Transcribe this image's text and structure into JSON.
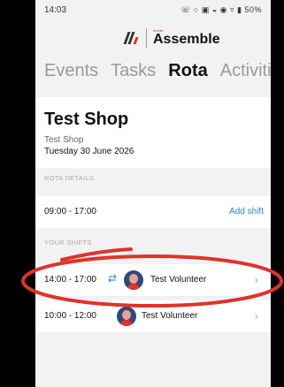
{
  "status_bar": {
    "time": "14:03",
    "system_icons": "☏ ○ ▣ ◒ ◉ ▿ ▮ 50%"
  },
  "logo": {
    "brand_text": "mobile",
    "name": "Assemble"
  },
  "tabs": [
    {
      "label": "Events",
      "active": false
    },
    {
      "label": "Tasks",
      "active": false
    },
    {
      "label": "Rota",
      "active": true
    },
    {
      "label": "Activities",
      "active": false
    }
  ],
  "shop": {
    "title": "Test Shop",
    "subtitle": "Test Shop",
    "date": "Tuesday 30 June 2026"
  },
  "rota_details": {
    "section_label": "ROTA DETAILS",
    "time": "09:00 - 17:00",
    "add_shift_label": "Add shift"
  },
  "your_shifts": {
    "section_label": "YOUR SHIFTS",
    "items": [
      {
        "time": "14:00 - 17:00",
        "swap": true,
        "volunteer": "Test Volunteer"
      },
      {
        "time": "10:00 - 12:00",
        "swap": false,
        "volunteer": "Test Volunteer"
      }
    ]
  },
  "colors": {
    "accent": "#2a7fd4",
    "annotation": "#e0322c",
    "background": "#f2f2f2"
  }
}
